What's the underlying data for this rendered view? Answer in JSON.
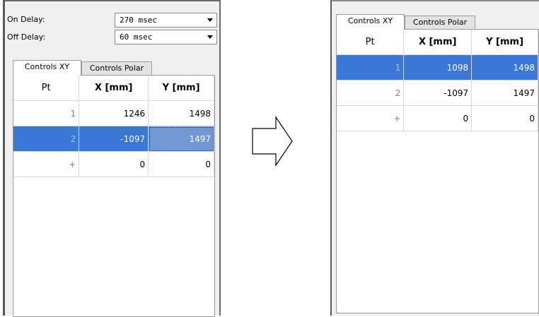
{
  "left": {
    "on_delay": {
      "label": "On Delay:",
      "value": "270 msec"
    },
    "off_delay": {
      "label": "Off Delay:",
      "value": "60 msec"
    },
    "tabs": [
      {
        "label": "Controls XY",
        "active": true
      },
      {
        "label": "Controls Polar",
        "active": false
      }
    ],
    "columns": [
      "Pt",
      "X [mm]",
      "Y [mm]"
    ],
    "rows": [
      {
        "pt": "1",
        "x": "1246",
        "y": "1498",
        "selected": false
      },
      {
        "pt": "2",
        "x": "-1097",
        "y": "1497",
        "selected": true
      },
      {
        "pt": "+",
        "x": "0",
        "y": "0",
        "selected": false
      }
    ]
  },
  "right": {
    "tabs": [
      {
        "label": "Controls XY",
        "active": true
      },
      {
        "label": "Controls Polar",
        "active": false
      }
    ],
    "columns": [
      "Pt",
      "X [mm]",
      "Y [mm]"
    ],
    "rows": [
      {
        "pt": "1",
        "x": "1098",
        "y": "1498",
        "selected": true
      },
      {
        "pt": "2",
        "x": "-1097",
        "y": "1497",
        "selected": false
      },
      {
        "pt": "+",
        "x": "0",
        "y": "0",
        "selected": false
      }
    ]
  },
  "icons": {
    "transition": "right-arrow-outline-icon"
  }
}
